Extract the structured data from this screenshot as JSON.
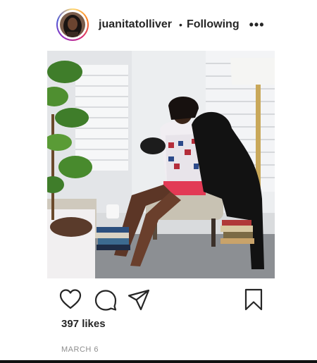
{
  "post": {
    "username": "juanitatolliver",
    "separator": "•",
    "follow_status": "Following",
    "more_label": "•••",
    "likes_text": "397 likes",
    "date_text": "MARCH 6"
  },
  "icons": {
    "like": "heart-icon",
    "comment": "comment-icon",
    "share": "share-icon",
    "save": "bookmark-icon"
  },
  "colors": {
    "text": "#262626",
    "muted": "#8e8e8e",
    "story_ring": [
      "#feda75",
      "#fa7e1e",
      "#d62976",
      "#962fbf",
      "#4f5bd5"
    ]
  }
}
